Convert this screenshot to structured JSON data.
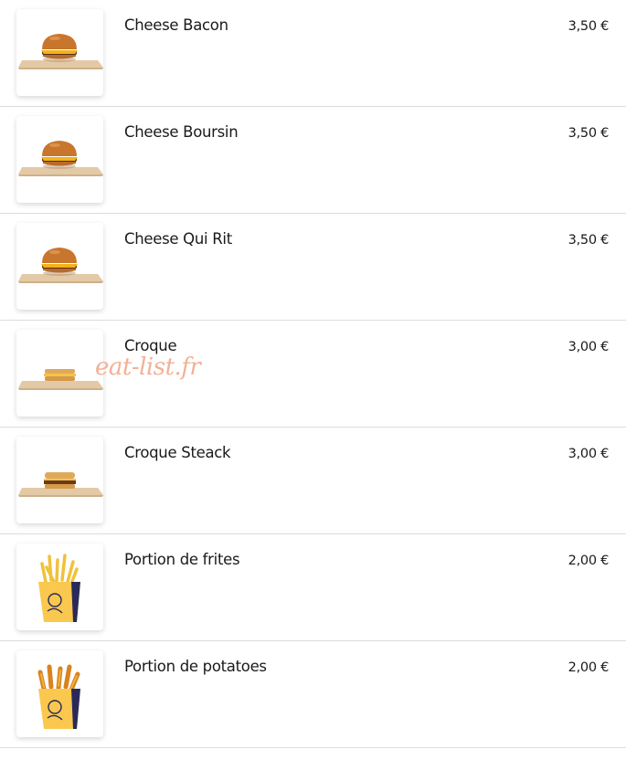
{
  "menu": {
    "items": [
      {
        "name": "Cheese Bacon",
        "price": "3,50 €",
        "image": "burger-image"
      },
      {
        "name": "Cheese Boursin",
        "price": "3,50 €",
        "image": "burger-image"
      },
      {
        "name": "Cheese Qui Rit",
        "price": "3,50 €",
        "image": "burger-image"
      },
      {
        "name": "Croque",
        "price": "3,00 €",
        "image": "croque-image"
      },
      {
        "name": "Croque Steack",
        "price": "3,00 €",
        "image": "croque-steack-image"
      },
      {
        "name": "Portion de frites",
        "price": "2,00 €",
        "image": "fries-image"
      },
      {
        "name": "Portion de potatoes",
        "price": "2,00 €",
        "image": "potatoes-image"
      }
    ]
  },
  "watermark": "eat-list.fr",
  "colors": {
    "separator": "#dcdcdc",
    "watermark": "#f2a483",
    "text": "#1a1a1a",
    "carton": "#fac84f",
    "carton_print": "#2a2a5a"
  }
}
